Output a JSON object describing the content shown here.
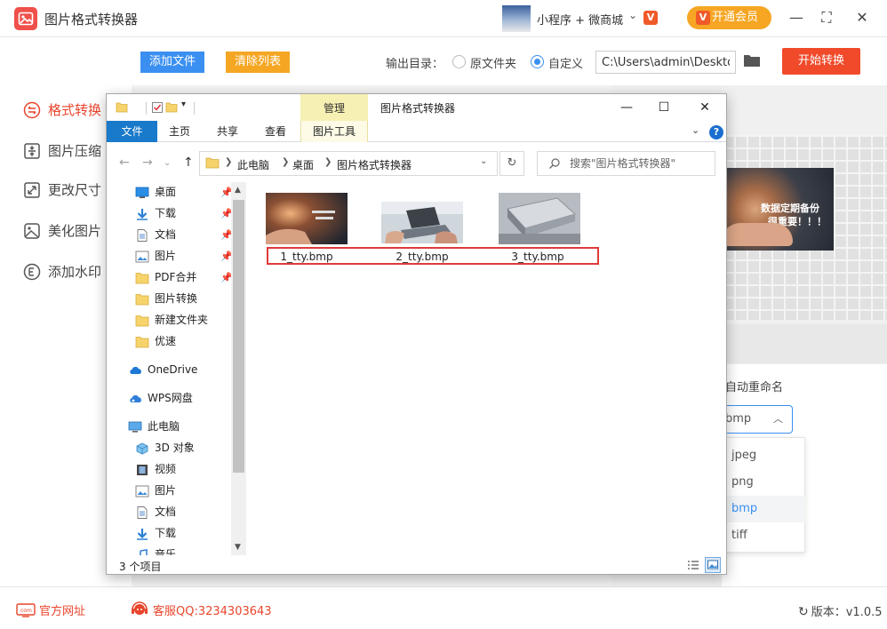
{
  "app": {
    "title": "图片格式转换器",
    "mini_program": "小程序 + 微商城",
    "vip_label": "开通会员",
    "vip_badge": "V",
    "mini_badge": "V",
    "window_controls": {
      "minimize": "—",
      "maximize": "⛶",
      "close": "✕"
    }
  },
  "toolbar": {
    "add_files": "添加文件",
    "clear_list": "清除列表",
    "output_label": "输出目录：",
    "radio_original": "原文件夹",
    "radio_custom": "自定义",
    "output_path": "C:\\Users\\admin\\Desktop",
    "start": "开始转换",
    "brand_colors": {
      "accent": "#3a8ff0",
      "start": "#f04a2a",
      "orange": "#f5a623"
    }
  },
  "sidebar": {
    "items": [
      {
        "label": "格式转换",
        "icon": "convert-icon",
        "active": true
      },
      {
        "label": "图片压缩",
        "icon": "compress-icon",
        "active": false
      },
      {
        "label": "更改尺寸",
        "icon": "resize-icon",
        "active": false
      },
      {
        "label": "美化图片",
        "icon": "beautify-icon",
        "active": false
      },
      {
        "label": "添加水印",
        "icon": "watermark-icon",
        "active": false
      }
    ]
  },
  "panel": {
    "rename_label": "自动重命名",
    "selected_format": "bmp",
    "preview_line1": "数据定期备份",
    "preview_line2": "很重要！！！",
    "formats": [
      "jpeg",
      "png",
      "bmp",
      "tiff"
    ]
  },
  "footer": {
    "website": "官方网址",
    "qq": "客服QQ:3234303643",
    "version": "版本：v1.0.5"
  },
  "explorer": {
    "context_tab": "管理",
    "title": "图片格式转换器",
    "tabs": {
      "file": "文件",
      "home": "主页",
      "share": "共享",
      "view": "查看",
      "picture_tools": "图片工具"
    },
    "breadcrumb": [
      "此电脑",
      "桌面",
      "图片格式转换器"
    ],
    "search_placeholder": "搜索\"图片格式转换器\"",
    "nav": {
      "quick": [
        {
          "label": "桌面",
          "icon": "desktop-icon",
          "pinned": true
        },
        {
          "label": "下载",
          "icon": "download-icon",
          "pinned": true
        },
        {
          "label": "文档",
          "icon": "document-icon",
          "pinned": true
        },
        {
          "label": "图片",
          "icon": "picture-icon",
          "pinned": true
        },
        {
          "label": "PDF合并",
          "icon": "folder-icon",
          "pinned": true
        },
        {
          "label": "图片转换",
          "icon": "folder-icon",
          "pinned": false
        },
        {
          "label": "新建文件夹",
          "icon": "folder-icon",
          "pinned": false
        },
        {
          "label": "优速",
          "icon": "folder-icon",
          "pinned": false
        }
      ],
      "onedrive": "OneDrive",
      "wps": "WPS网盘",
      "this_pc": "此电脑",
      "pc_items": [
        {
          "label": "3D 对象",
          "icon": "3d-objects-icon"
        },
        {
          "label": "视频",
          "icon": "video-icon"
        },
        {
          "label": "图片",
          "icon": "picture-icon"
        },
        {
          "label": "文档",
          "icon": "document-icon"
        },
        {
          "label": "下载",
          "icon": "download-icon"
        },
        {
          "label": "音乐",
          "icon": "music-icon"
        }
      ]
    },
    "files": [
      {
        "name": "1_tty.bmp"
      },
      {
        "name": "2_tty.bmp"
      },
      {
        "name": "3_tty.bmp"
      }
    ],
    "status": "3 个项目"
  }
}
